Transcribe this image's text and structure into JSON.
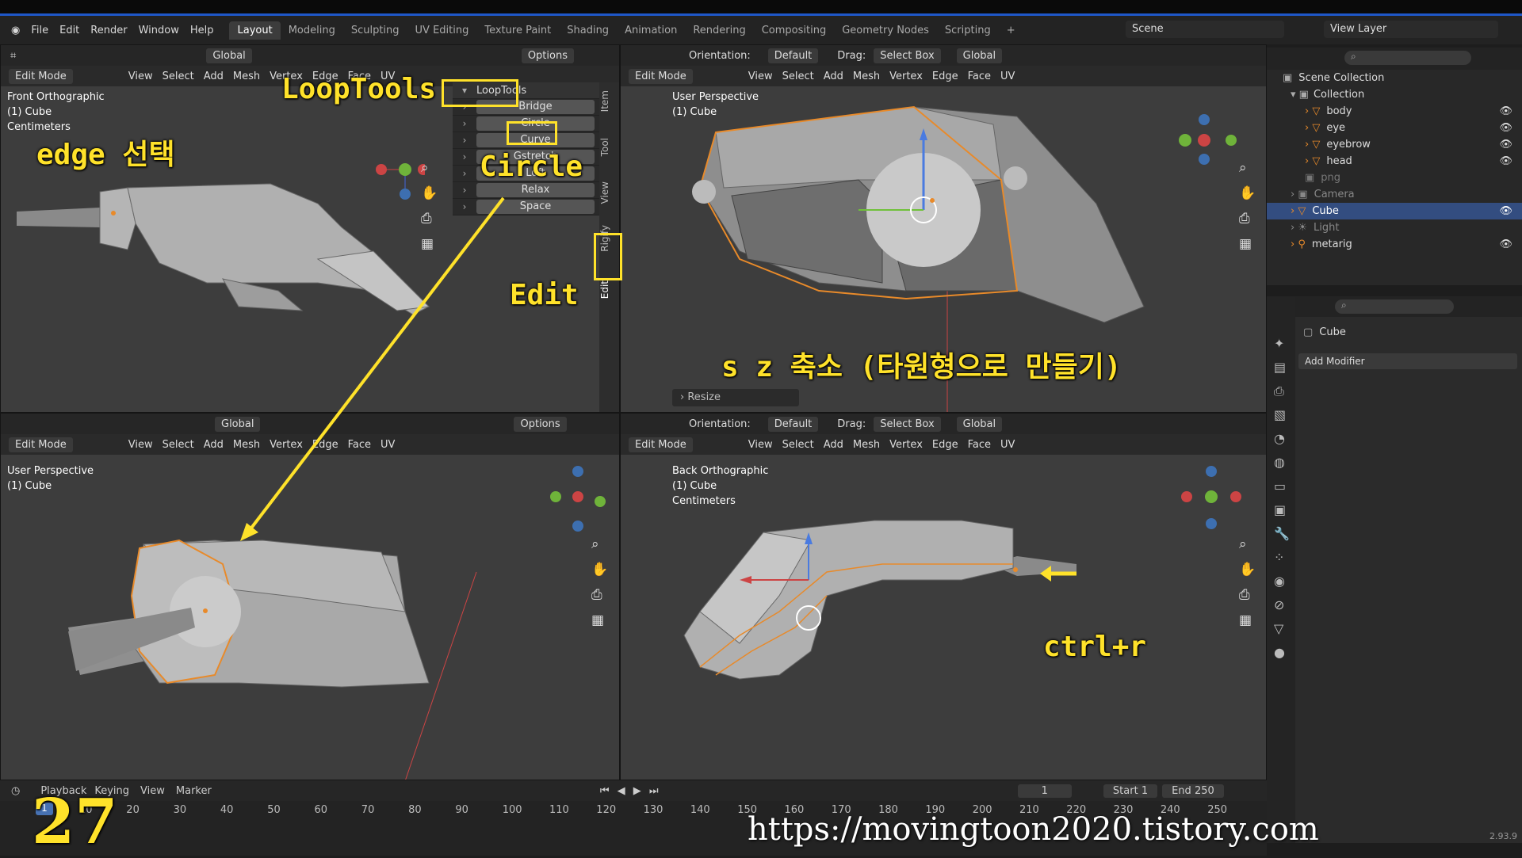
{
  "menu": [
    "File",
    "Edit",
    "Render",
    "Window",
    "Help"
  ],
  "workspaces": [
    "Layout",
    "Modeling",
    "Sculpting",
    "UV Editing",
    "Texture Paint",
    "Shading",
    "Animation",
    "Rendering",
    "Compositing",
    "Geometry Nodes",
    "Scripting",
    "+"
  ],
  "scene": "Scene",
  "view_layer": "View Layer",
  "header_left": {
    "mode": "Edit Mode",
    "view": "View",
    "select": "Select",
    "add": "Add",
    "mesh": "Mesh",
    "vertex": "Vertex",
    "edge": "Edge",
    "face": "Face",
    "uv": "UV",
    "transform": "Global",
    "options": "Options"
  },
  "header_right": {
    "orientation_label": "Orientation:",
    "orientation_value": "Default",
    "drag_label": "Drag:",
    "drag_value": "Select Box",
    "transform": "Global"
  },
  "viewports": {
    "top_left": {
      "label1": "Front Orthographic",
      "label2": "(1) Cube",
      "label3": "Centimeters"
    },
    "top_right": {
      "label1": "User Perspective",
      "label2": "(1) Cube",
      "operator": "Resize"
    },
    "bottom_left": {
      "label1": "User Perspective",
      "label2": "(1) Cube"
    },
    "bottom_right": {
      "label1": "Back Orthographic",
      "label2": "(1) Cube",
      "label3": "Centimeters"
    }
  },
  "looptools": {
    "title": "LoopTools",
    "items": [
      "Bridge",
      "Circle",
      "Curve",
      "Gstretch",
      "Loft",
      "Relax",
      "Space"
    ]
  },
  "sidebar_tabs": [
    "Item",
    "Tool",
    "View",
    "Rigify",
    "Edit"
  ],
  "annotations": {
    "looptools": "LoopTools",
    "circle": "Circle",
    "edge_select": "edge 선택",
    "edit": "Edit",
    "scale_z": "s z 축소 (타원형으로 만들기)",
    "ctrl_r": "ctrl+r",
    "frame": "27",
    "url": "https://movingtoon2020.tistory.com"
  },
  "outliner": {
    "root": "Scene Collection",
    "collection": "Collection",
    "items": [
      "body",
      "eye",
      "eyebrow",
      "head",
      "png",
      "Camera",
      "Cube",
      "Light",
      "metarig"
    ]
  },
  "properties": {
    "object": "Cube",
    "add_modifier": "Add Modifier"
  },
  "timeline": {
    "playback": "Playback",
    "keying": "Keying",
    "view": "View",
    "marker": "Marker",
    "current": "1",
    "start_label": "Start",
    "start": "1",
    "end_label": "End",
    "end": "250",
    "ticks": [
      "10",
      "20",
      "30",
      "40",
      "50",
      "60",
      "70",
      "80",
      "90",
      "100",
      "110",
      "120",
      "130",
      "140",
      "150",
      "160",
      "170",
      "180",
      "190",
      "200",
      "210",
      "220",
      "230",
      "240",
      "250"
    ]
  },
  "version": "2.93.9",
  "colors": {
    "accent": "#4772b3",
    "annotation": "#ffe22a",
    "selection": "#e88a2a"
  }
}
